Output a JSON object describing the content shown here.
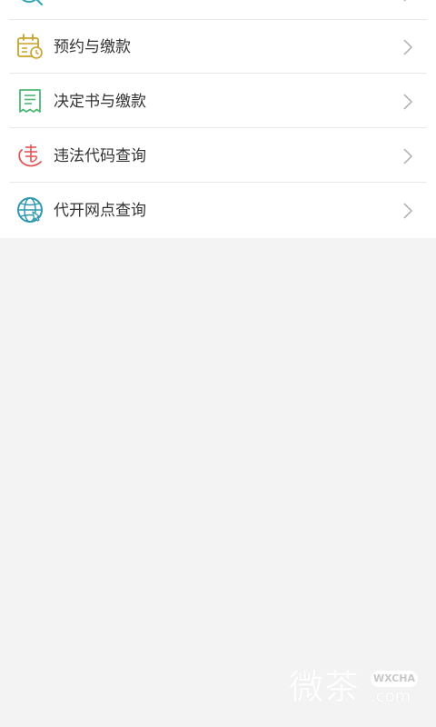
{
  "menu": {
    "items": [
      {
        "label": "",
        "icon": "search-icon"
      },
      {
        "label": "预约与缴款",
        "icon": "calendar-clock-icon"
      },
      {
        "label": "决定书与缴款",
        "icon": "receipt-icon"
      },
      {
        "label": "违法代码查询",
        "icon": "violation-code-icon"
      },
      {
        "label": "代开网点查询",
        "icon": "globe-icon"
      }
    ]
  },
  "watermark": {
    "text": "微茶",
    "badge": "WXCHA",
    "domain": ".com"
  },
  "colors": {
    "background": "#f2f3f2",
    "list_background": "#ffffff",
    "text": "#333333",
    "chevron": "#b5b5b5",
    "icon_teal": "#3aa7b7",
    "icon_gold": "#c9a227",
    "icon_green": "#4cb874",
    "icon_red": "#e35656"
  }
}
